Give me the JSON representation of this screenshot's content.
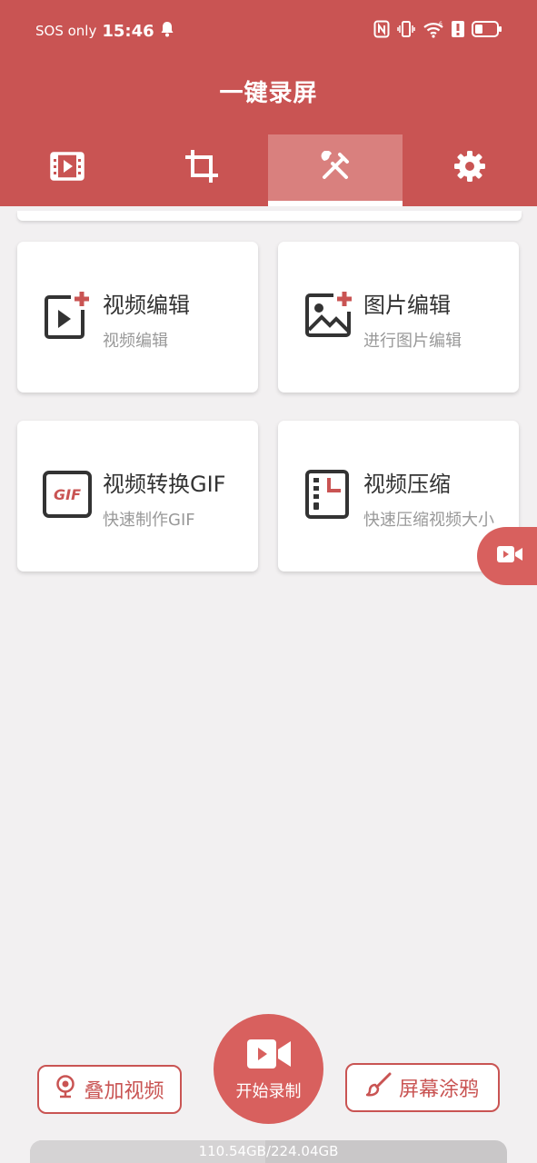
{
  "status_bar": {
    "carrier": "SOS only",
    "time": "15:46",
    "icons": [
      "bell-icon",
      "nfc-icon",
      "vibrate-icon",
      "wifi-icon",
      "alert-icon",
      "battery-icon"
    ]
  },
  "app": {
    "title": "一键录屏"
  },
  "tabs": [
    {
      "icon": "video-list-icon",
      "active": false
    },
    {
      "icon": "crop-icon",
      "active": false
    },
    {
      "icon": "tools-icon",
      "active": true
    },
    {
      "icon": "settings-icon",
      "active": false
    }
  ],
  "tools": [
    {
      "title": "视频编辑",
      "subtitle": "视频编辑",
      "icon": "video-edit-icon"
    },
    {
      "title": "图片编辑",
      "subtitle": "进行图片编辑",
      "icon": "image-edit-icon"
    },
    {
      "title": "视频转换GIF",
      "subtitle": "快速制作GIF",
      "icon": "gif-icon"
    },
    {
      "title": "视频压缩",
      "subtitle": "快速压缩视频大小",
      "icon": "compress-icon"
    }
  ],
  "bottom": {
    "overlay_label": "叠加视频",
    "record_label": "开始录制",
    "doodle_label": "屏幕涂鸦"
  },
  "storage": {
    "text": "110.54GB/224.04GB",
    "used_fraction": 0.493
  },
  "colors": {
    "primary": "#c95453",
    "accent": "#d8605e",
    "background": "#f2f0f1"
  }
}
